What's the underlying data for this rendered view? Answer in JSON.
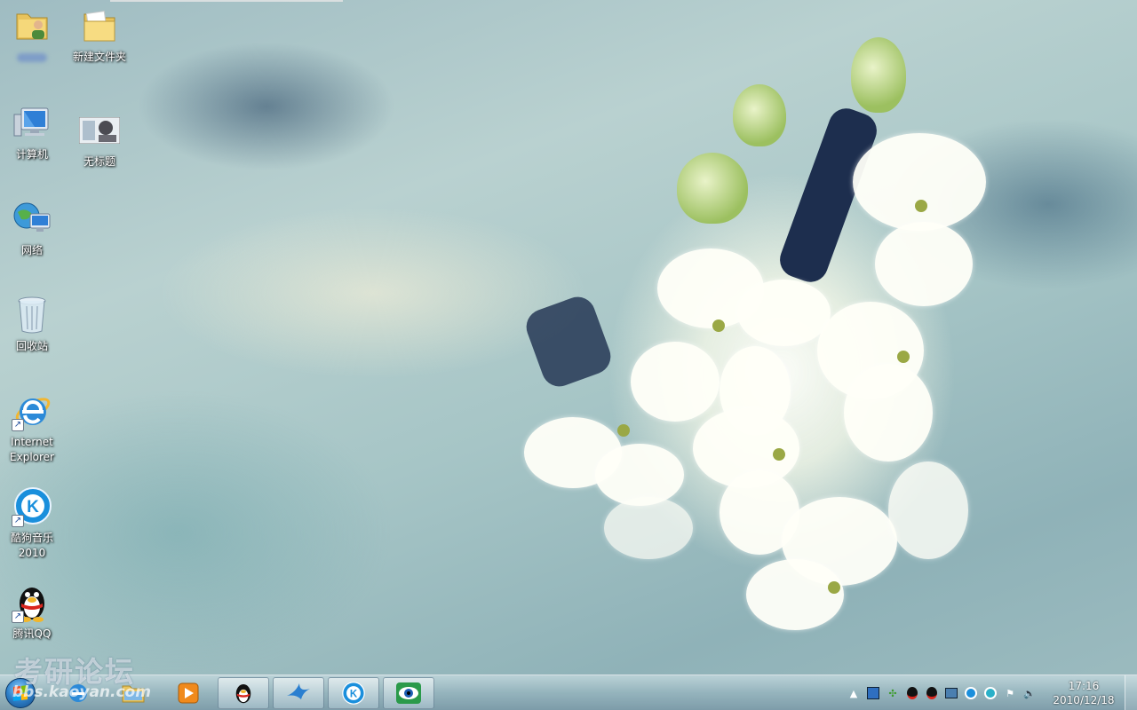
{
  "desktop": {
    "icons": [
      {
        "label": ""
      },
      {
        "label": "新建文件夹"
      },
      {
        "label": "计算机"
      },
      {
        "label": "无标题"
      },
      {
        "label": "网络"
      },
      {
        "label": "回收站"
      },
      {
        "label": "Internet\nExplorer"
      },
      {
        "label": "酷狗音乐\n2010"
      },
      {
        "label": "腾讯QQ"
      }
    ]
  },
  "watermark": {
    "text": "考研论坛",
    "url": "bbs.kaoyan.com"
  },
  "taskbar": {
    "clock": {
      "time": "17:16",
      "date": "2010/12/18"
    },
    "colors": {
      "accent": "#2d7fc8",
      "qq_red": "#d9251d",
      "kugou_blue": "#1a8fdc"
    }
  }
}
